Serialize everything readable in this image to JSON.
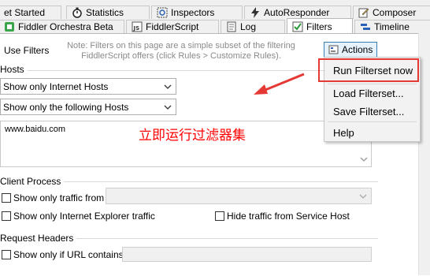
{
  "tabs_row1": [
    {
      "label": "et Started",
      "icon": "get-started-icon"
    },
    {
      "label": "Statistics",
      "icon": "stopwatch-icon"
    },
    {
      "label": "Inspectors",
      "icon": "inspectors-icon"
    },
    {
      "label": "AutoResponder",
      "icon": "lightning-icon"
    },
    {
      "label": "Composer",
      "icon": "composer-icon"
    }
  ],
  "tabs_row2": [
    {
      "label": "Fiddler Orchestra Beta",
      "icon": "orchestra-icon"
    },
    {
      "label": "FiddlerScript",
      "icon": "js-icon"
    },
    {
      "label": "Log",
      "icon": "log-icon"
    },
    {
      "label": "Filters",
      "icon": "checkbox-icon",
      "active": true
    },
    {
      "label": "Timeline",
      "icon": "timeline-icon"
    }
  ],
  "filters": {
    "use_filters_label": "Use Filters",
    "note": "Note: Filters on this page are a simple subset of the filtering FiddlerScript offers (click Rules > Customize Rules).",
    "actions_button": "Actions",
    "hosts_group": "Hosts",
    "hosts_zone_combo": "Show only Internet Hosts",
    "hosts_filter_combo": "Show only the following Hosts",
    "hosts_textarea": "www.baidu.com",
    "annotation": "立即运行过滤器集",
    "client_process_group": "Client Process",
    "show_only_traffic_from": "Show only traffic from",
    "show_only_ie": "Show only Internet Explorer traffic",
    "hide_service_host": "Hide traffic from Service Host",
    "request_headers_group": "Request Headers",
    "show_only_url_contains": "Show only if URL contains"
  },
  "actions_menu": {
    "items": [
      "Run Filterset now",
      "Load Filterset...",
      "Save Filterset...",
      "Help"
    ]
  },
  "colors": {
    "highlight": "#e53935",
    "annotation_text": "#ff0000",
    "accent": "#3c7fb1"
  }
}
